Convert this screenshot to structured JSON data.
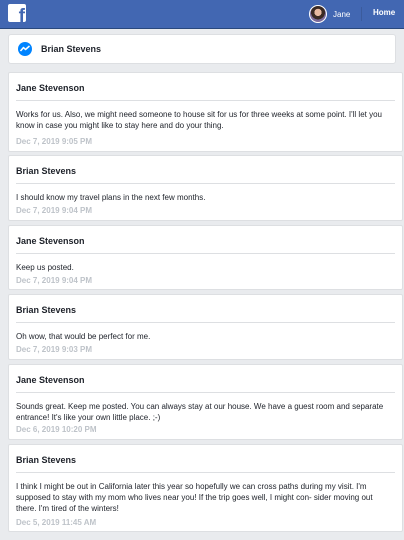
{
  "topbar": {
    "user_name": "Jane",
    "home_label": "Home"
  },
  "header": {
    "title": "Brian Stevens"
  },
  "messages": [
    {
      "author": "Jane Stevenson",
      "text": "Works for us. Also, we might need someone to house sit for us for three weeks at some point. I'll let you know in case you might like to stay here and do your thing.",
      "time": "Dec 7, 2019 9:05 PM"
    },
    {
      "author": "Brian Stevens",
      "text": "I should know my travel plans in the next few months.",
      "time": "Dec 7, 2019 9:04 PM"
    },
    {
      "author": "Jane Stevenson",
      "text": "Keep us posted.",
      "time": "Dec 7, 2019 9:04 PM"
    },
    {
      "author": "Brian Stevens",
      "text": "Oh wow, that would be perfect for me.",
      "time": "Dec 7, 2019 9:03 PM"
    },
    {
      "author": "Jane Stevenson",
      "text": "Sounds great. Keep me posted. You can always stay at our house. We have a guest room and separate entrance! It's like your own little place. ;-)",
      "time": "Dec 6, 2019 10:20 PM"
    },
    {
      "author": "Brian Stevens",
      "text": "I think I might be out in California later this year so hopefully we can cross paths during my visit. I'm supposed to stay with my mom who lives near you! If the trip goes well, I might con- sider moving out there. I'm tired of the winters!",
      "time": "Dec 5, 2019 11:45 AM"
    }
  ]
}
